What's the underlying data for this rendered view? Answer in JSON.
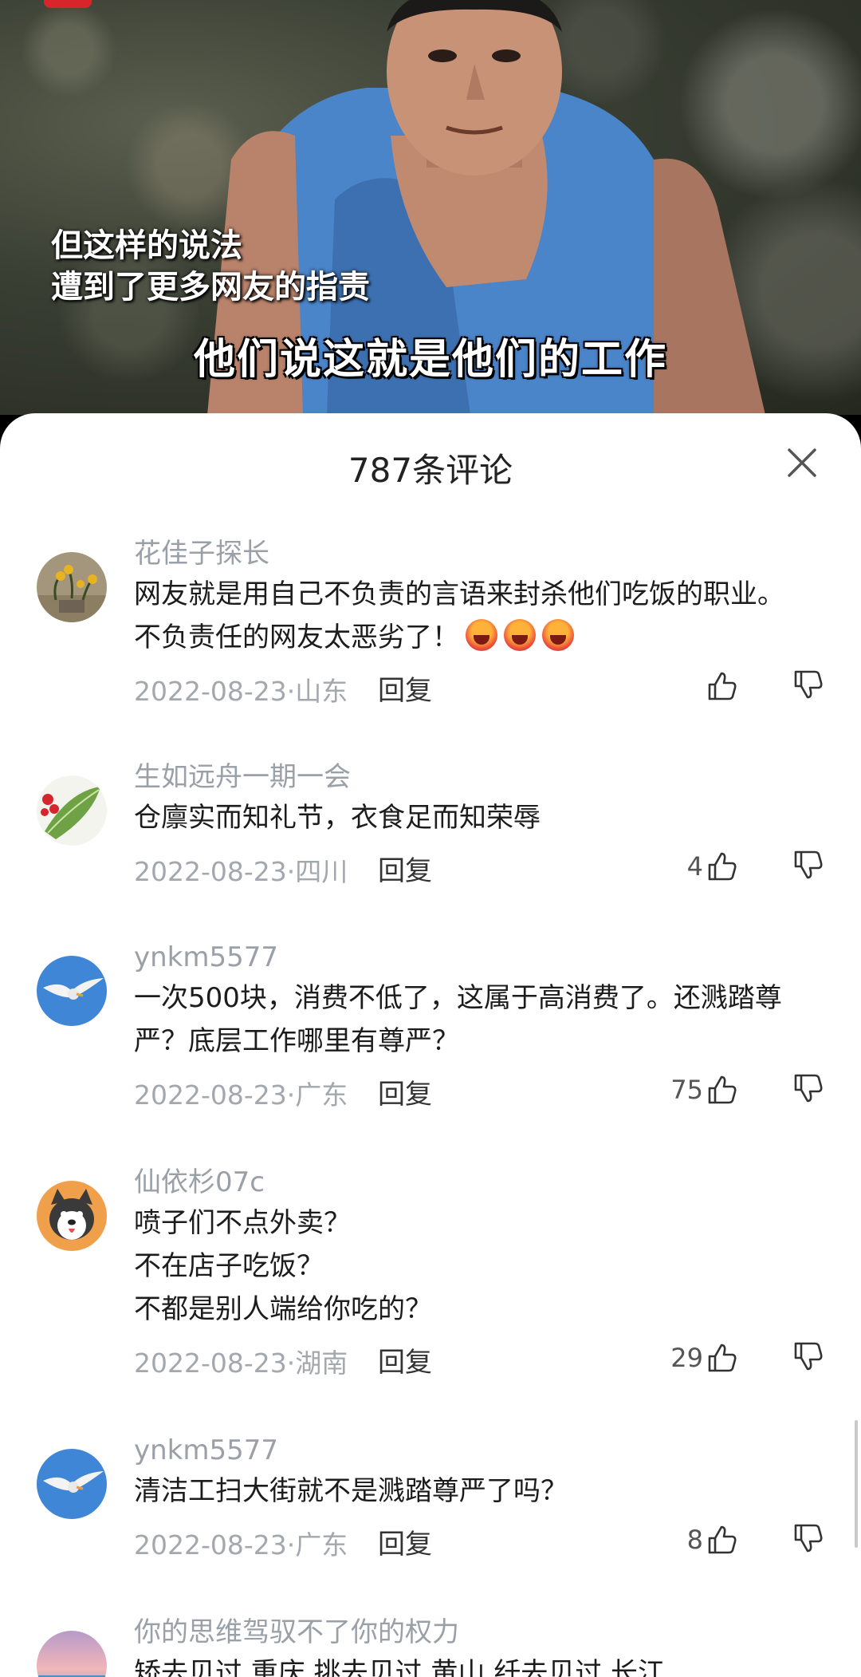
{
  "video": {
    "subtitle_line1": "但这样的说法",
    "subtitle_line2": "遭到了更多网友的指责",
    "caption": "他们说这就是他们的工作"
  },
  "sheet": {
    "title": "787条评论",
    "reply_label": "回复"
  },
  "comments": [
    {
      "user": "花佳子探长",
      "text": "网友就是用自己不负责的言语来封杀他们吃饭的职业。\n不负责任的网友太恶劣了！",
      "emoji_count": 3,
      "date": "2022-08-23·山东",
      "likes": ""
    },
    {
      "user": "生如远舟一期一会",
      "text": "仓廪实而知礼节，衣食足而知荣辱",
      "date": "2022-08-23·四川",
      "likes": "4"
    },
    {
      "user": "ynkm5577",
      "text": "一次500块，消费不低了，这属于高消费了。还溅踏尊严？底层工作哪里有尊严？",
      "date": "2022-08-23·广东",
      "likes": "75"
    },
    {
      "user": "仙依杉07c",
      "text": "喷子们不点外卖？\n不在店子吃饭？\n不都是别人端给你吃的？",
      "date": "2022-08-23·湖南",
      "likes": "29"
    },
    {
      "user": "ynkm5577",
      "text": "清洁工扫大街就不是溅踏尊严了吗？",
      "date": "2022-08-23·广东",
      "likes": "8"
    },
    {
      "user": "你的思维驾驭不了你的权力",
      "text": "矫去贝过 重庆 挑去贝过 黄山 纤去贝过 长江",
      "date": "",
      "likes": ""
    }
  ],
  "colors": {
    "accent_red": "#d8252b",
    "meta_gray": "#a3a8ae",
    "text_dark": "#1c1c1c"
  }
}
